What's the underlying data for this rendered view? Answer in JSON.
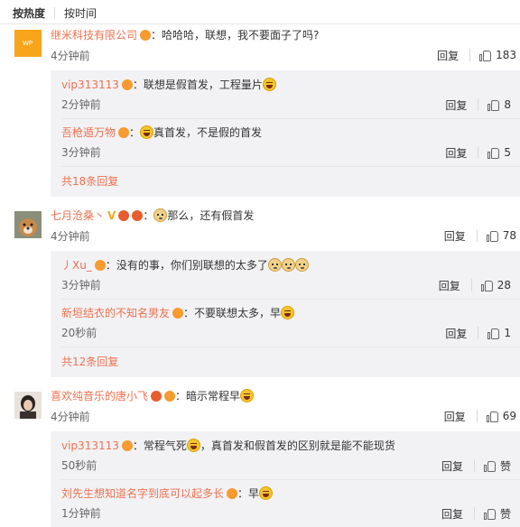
{
  "sort": {
    "hot": "按热度",
    "time": "按时间"
  },
  "comments": [
    {
      "user": "继米科技有限公司",
      "text": "哈哈哈，联想，我不要面子了吗?",
      "time": "4分钟前",
      "reply": "回复",
      "likes": "183",
      "replies": [
        {
          "user": "vip313113",
          "text": "联想是假首发，工程量片",
          "time": "2分钟前",
          "reply": "回复",
          "likes": "8"
        },
        {
          "user": "吾枪遁万物",
          "text": "真首发，不是假的首发",
          "time": "3分钟前",
          "reply": "回复",
          "likes": "5"
        }
      ],
      "more": "共18条回复"
    },
    {
      "user": "七月沧桑丶",
      "text": "那么，还有假首发",
      "time": "4分钟前",
      "reply": "回复",
      "likes": "78",
      "replies": [
        {
          "user": "丿Xu_",
          "text": "没有的事，你们别联想的太多了",
          "time": "3分钟前",
          "reply": "回复",
          "likes": "28"
        },
        {
          "user": "新垣结衣的不知名男友",
          "text": "不要联想太多，早",
          "time": "20秒前",
          "reply": "回复",
          "likes": "1"
        }
      ],
      "more": "共12条回复"
    },
    {
      "user": "喜欢纯音乐的唐小飞",
      "text": "暗示常程早",
      "time": "4分钟前",
      "reply": "回复",
      "likes": "69",
      "replies": [
        {
          "user": "vip313113",
          "text_a": "常程气死",
          "text_b": "，真首发和假首发的区别就是能不能现货",
          "time": "50秒前",
          "reply": "回复",
          "likes": "赞"
        },
        {
          "user": "刘先生想知道名字到底可以起多长",
          "text": "早",
          "time": "1分钟前",
          "reply": "回复",
          "likes": "赞"
        }
      ]
    }
  ],
  "icons": {
    "thumb": "thumb-up-icon",
    "laugh": "laugh-emoji",
    "doge": "doge-emoji"
  },
  "colors": {
    "username": "#eb7350",
    "reply_bg": "#f2f2f5"
  }
}
